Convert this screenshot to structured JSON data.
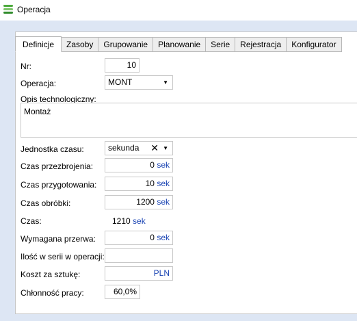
{
  "window": {
    "title": "Operacja"
  },
  "tabs": [
    "Definicje",
    "Zasoby",
    "Grupowanie",
    "Planowanie",
    "Serie",
    "Rejestracja",
    "Konfigurator"
  ],
  "form": {
    "nr": {
      "label": "Nr:",
      "value": "10"
    },
    "operacja": {
      "label": "Operacja:",
      "value": "MONT"
    },
    "opis": {
      "label": "Opis technologiczny:",
      "value": "Montaż"
    },
    "jednostka": {
      "label": "Jednostka czasu:",
      "value": "sekunda"
    },
    "przezbrojenie": {
      "label": "Czas przezbrojenia:",
      "value": "0",
      "unit": "sek"
    },
    "przygotowanie": {
      "label": "Czas przygotowania:",
      "value": "10",
      "unit": "sek"
    },
    "obrobka": {
      "label": "Czas obróbki:",
      "value": "1200",
      "unit": "sek"
    },
    "czas": {
      "label": "Czas:",
      "value": "1210",
      "unit": "sek"
    },
    "przerwa": {
      "label": "Wymagana przerwa:",
      "value": "0",
      "unit": "sek"
    },
    "ilosc": {
      "label": "Ilość w serii w operacji:",
      "value": ""
    },
    "koszt": {
      "label": "Koszt za sztukę:",
      "value": "",
      "unit": "PLN"
    },
    "chlonnosc": {
      "label": "Chłonność pracy:",
      "value": "60,0%"
    }
  },
  "icons": {
    "app": "operation-icon",
    "dropdown": "chevron-down-icon",
    "clear": "clear-icon"
  },
  "colors": {
    "unit": "#1a44b3",
    "workspace": "#dde6f4"
  }
}
